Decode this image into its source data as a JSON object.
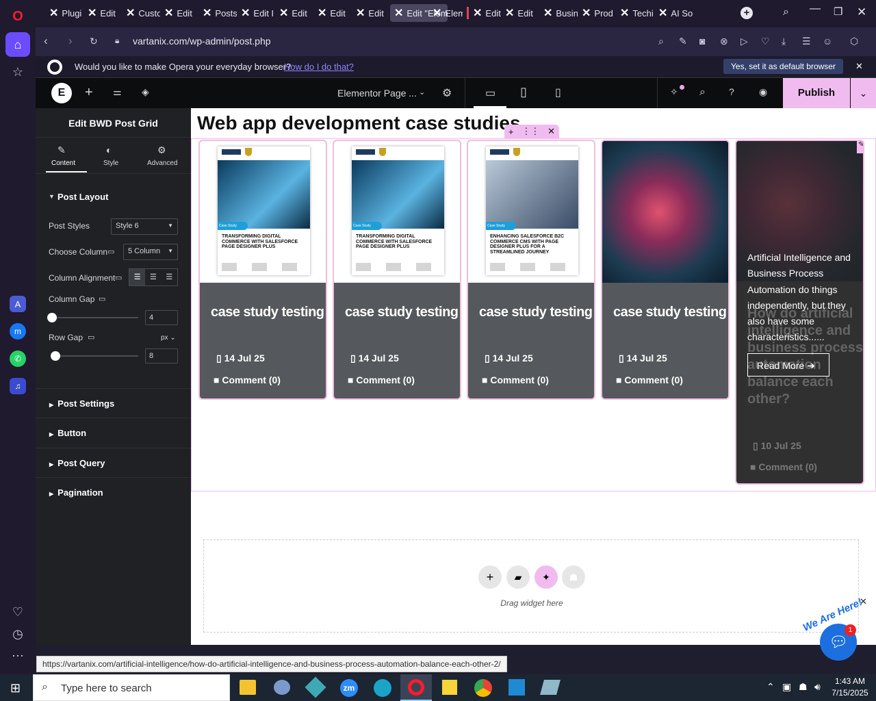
{
  "tabs": [
    "Plugi",
    "Edit",
    "Custo",
    "Edit",
    "Posts",
    "Edit I",
    "Edit",
    "Edit",
    "Edit",
    "Edit \"Elem",
    "Elem",
    "Edit",
    "Edit",
    "Busin",
    "Prod",
    "Techi",
    "AI So"
  ],
  "address": {
    "url": "vartanix.com/wp-admin/post.php"
  },
  "default_bar": {
    "question": "Would you like to make Opera your everyday browser?",
    "link": "How do I do that?",
    "button": "Yes, set it as default browser"
  },
  "elementor": {
    "page_label": "Elementor Page ...",
    "publish": "Publish"
  },
  "panel": {
    "title": "Edit BWD Post Grid",
    "tabs": [
      "Content",
      "Style",
      "Advanced"
    ],
    "section": "Post Layout",
    "post_styles_label": "Post Styles",
    "post_styles_value": "Style 6",
    "choose_column_label": "Choose Column",
    "choose_column_value": "5 Column",
    "column_alignment_label": "Column Alignment",
    "column_gap_label": "Column Gap",
    "column_gap_value": "4",
    "row_gap_label": "Row Gap",
    "row_gap_unit": "px",
    "row_gap_value": "8",
    "sections": [
      "Post Settings",
      "Button",
      "Post Query",
      "Pagination"
    ]
  },
  "canvas": {
    "heading": "Web app development case studies",
    "cards": [
      {
        "title": "case study testing",
        "date": "14 Jul 25",
        "comment": "Comment (0)",
        "img_text": "TRANSFORMING DIGITAL COMMERCE WITH SALESFORCE PAGE DESIGNER PLUS",
        "img_tag": "Case Study"
      },
      {
        "title": "case study testing",
        "date": "14 Jul 25",
        "comment": "Comment (0)",
        "img_text": "TRANSFORMING DIGITAL COMMERCE WITH SALESFORCE PAGE DESIGNER PLUS",
        "img_tag": "Case Study"
      },
      {
        "title": "case study testing",
        "date": "14 Jul 25",
        "comment": "Comment (0)",
        "img_text": "ENHANCING SALESFORCE B2C COMMERCE CMS WITH PAGE DESIGNER PLUS FOR A STREAMLINED JOURNEY",
        "img_tag": "Case Study"
      },
      {
        "title": "case study testing",
        "date": "14 Jul 25",
        "comment": "Comment (0)"
      }
    ],
    "hover_card": {
      "excerpt": "Artificial Intelligence and Business Process Automation do things independently, but they also have some characteristics......",
      "read_more": "Read More",
      "title": "How do artificial intelligence and business process automation balance each other?",
      "date": "10 Jul 25",
      "comment": "Comment (0)"
    },
    "drag_hint": "Drag widget here"
  },
  "status_url": "https://vartanix.com/artificial-intelligence/how-do-artificial-intelligence-and-business-process-automation-balance-each-other-2/",
  "taskbar": {
    "search_placeholder": "Type here to search",
    "time": "1:43 AM",
    "date": "7/15/2025"
  },
  "chat": {
    "badge": "1",
    "label": "We Are Here!"
  }
}
